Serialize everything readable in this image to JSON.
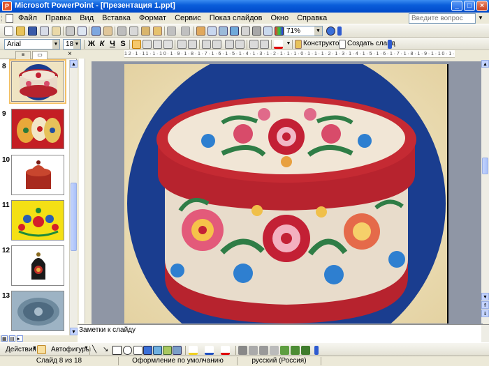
{
  "window": {
    "title": "Microsoft PowerPoint - [Презентация 1.ppt]",
    "minimize": "_",
    "maximize": "□",
    "close": "×"
  },
  "menu": {
    "items": [
      "Файл",
      "Правка",
      "Вид",
      "Вставка",
      "Формат",
      "Сервис",
      "Показ слайдов",
      "Окно",
      "Справка"
    ],
    "help_placeholder": "Введите вопрос"
  },
  "standard_toolbar": {
    "zoom": "71%"
  },
  "formatting_toolbar": {
    "font": "Arial",
    "size": "18",
    "bold": "Ж",
    "italic": "К",
    "underline": "Ч",
    "shadow": "S",
    "designer": "Конструктор",
    "new_slide": "Создать слайд"
  },
  "slides_pane": {
    "thumbnails": [
      {
        "number": "8",
        "selected": true
      },
      {
        "number": "9",
        "selected": false
      },
      {
        "number": "10",
        "selected": false
      },
      {
        "number": "11",
        "selected": false
      },
      {
        "number": "12",
        "selected": false
      },
      {
        "number": "13",
        "selected": false
      }
    ]
  },
  "ruler": {
    "text": "12·1·11·1·10·1·9·1·8·1·7·1·6·1·5·1·4·1·3·1·2·1·1·1·0·1·1·1·2·1·3·1·4·1·5·1·6·1·7·1·8·1·9·1·10·1·11·1·12"
  },
  "notes": {
    "placeholder": "Заметки к слайду"
  },
  "drawing_toolbar": {
    "actions": "Действия",
    "autoshapes": "Автофигуры"
  },
  "status": {
    "slide": "Слайд 8 из 18",
    "design": "Оформление по умолчанию",
    "language": "русский (Россия)"
  },
  "colors": {
    "titlebar": "#0A5EDB",
    "slide_background": "#EFE4C2",
    "circle": "#1A3D8F",
    "box_red": "#B7232E"
  }
}
